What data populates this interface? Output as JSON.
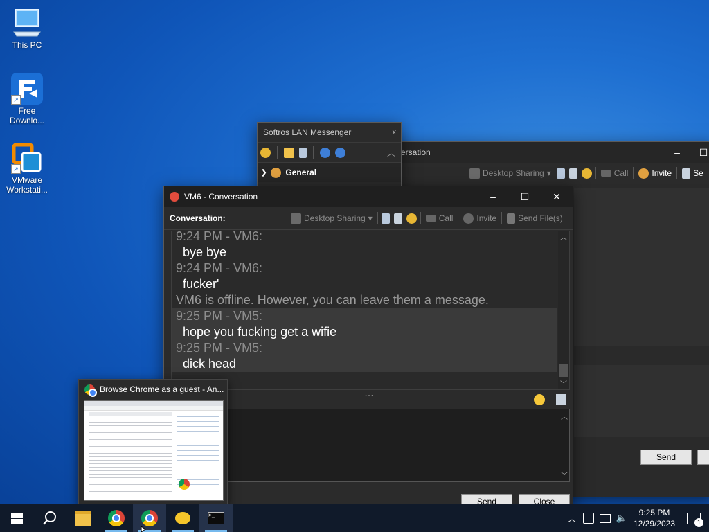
{
  "desktop": {
    "icons": [
      {
        "label": "This PC"
      },
      {
        "label": "Free Downlo..."
      },
      {
        "label": "VMware Workstati..."
      }
    ]
  },
  "messenger": {
    "title": "Softros LAN Messenger",
    "close_glyph": "x",
    "group": "General"
  },
  "back_window": {
    "title_fragment": "versation",
    "toolbar": {
      "desktop_sharing": "Desktop Sharing",
      "call": "Call",
      "invite": "Invite",
      "send_cut": "Se"
    },
    "send_label": "Send"
  },
  "conversation": {
    "title": "VM6 - Conversation",
    "label": "Conversation:",
    "toolbar": {
      "desktop_sharing": "Desktop Sharing",
      "call": "Call",
      "invite": "Invite",
      "send_files": "Send File(s)"
    },
    "messages": [
      {
        "head": "9:24 PM - VM6:",
        "body": "bye bye"
      },
      {
        "head": "9:24 PM - VM6:",
        "body": "fucker'"
      },
      {
        "system": "VM6 is offline. However, you can leave them a message."
      },
      {
        "head": "9:25 PM - VM5:",
        "body": "hope you fucking get a wifie"
      },
      {
        "head": "9:25 PM - VM5:",
        "body": "dick head"
      }
    ],
    "splitter_glyph": "…",
    "send_label": "Send",
    "close_label": "Close"
  },
  "chrome_preview": {
    "title": "Browse Chrome as a guest - An..."
  },
  "taskbar": {
    "time": "9:25 PM",
    "date": "12/29/2023",
    "notification_count": "1"
  }
}
